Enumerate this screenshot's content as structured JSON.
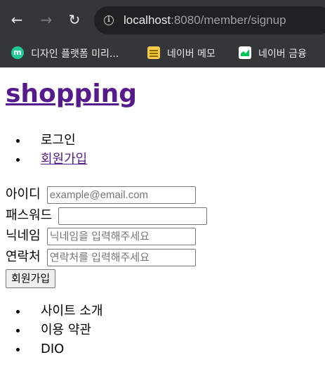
{
  "browser": {
    "url_host": "localhost",
    "url_path": ":8080/member/signup",
    "nav": {
      "back": "←",
      "forward": "→",
      "reload": "↻"
    },
    "bookmarks": [
      {
        "label": "디자인 플랫폼 미리...",
        "icon": "m-logo-icon",
        "icon_text": "m",
        "color": "#20c997"
      },
      {
        "label": "네이버 메모",
        "icon": "memo-icon",
        "color": "#f7c948"
      },
      {
        "label": "네이버 금융",
        "icon": "finance-chart-icon",
        "color": "#03c75a"
      }
    ]
  },
  "page": {
    "title": "shopping",
    "menu": [
      {
        "label": "로그인",
        "link": false
      },
      {
        "label": "회원가입",
        "link": true
      }
    ],
    "form": {
      "id_label": "아이디",
      "id_placeholder": "example@email.com",
      "pw_label": "패스워드",
      "pw_placeholder": "",
      "nick_label": "닉네임",
      "nick_placeholder": "닉네임을 입력해주세요",
      "contact_label": "연락처",
      "contact_placeholder": "연락처를 입력해주세요",
      "submit_label": "회원가입"
    },
    "footer": [
      {
        "label": "사이트 소개"
      },
      {
        "label": "이용 약관"
      },
      {
        "label": "DIO"
      }
    ]
  },
  "colors": {
    "chrome_bg": "#35363a",
    "omnibox_bg": "#202124",
    "visited_link": "#551a8b"
  }
}
